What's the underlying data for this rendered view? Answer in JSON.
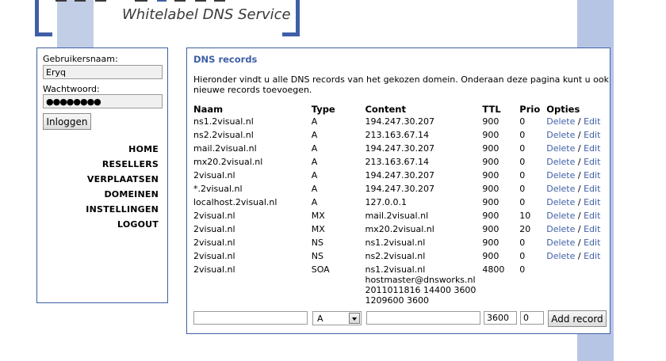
{
  "logo": {
    "tagline": "Whitelabel DNS Service"
  },
  "login": {
    "username_label": "Gebruikersnaam:",
    "username_value": "Eryq",
    "password_label": "Wachtwoord:",
    "password_value": "●●●●●●●●",
    "login_button": "Inloggen"
  },
  "menu": [
    "HOME",
    "RESELLERS",
    "VERPLAATSEN",
    "DOMEINEN",
    "INSTELLINGEN",
    "LOGOUT"
  ],
  "panel": {
    "title": "DNS records",
    "intro": "Hieronder vindt u alle DNS records van het gekozen domein. Onderaan deze pagina kunt u ook nieuwe records toevoegen."
  },
  "table": {
    "headers": [
      "Naam",
      "Type",
      "Content",
      "TTL",
      "Prio",
      "Opties"
    ],
    "rows": [
      {
        "naam": "ns1.2visual.nl",
        "type": "A",
        "content": "194.247.30.207",
        "ttl": "900",
        "prio": "0",
        "delete": "Delete",
        "edit": "Edit"
      },
      {
        "naam": "ns2.2visual.nl",
        "type": "A",
        "content": "213.163.67.14",
        "ttl": "900",
        "prio": "0",
        "delete": "Delete",
        "edit": "Edit"
      },
      {
        "naam": "mail.2visual.nl",
        "type": "A",
        "content": "194.247.30.207",
        "ttl": "900",
        "prio": "0",
        "delete": "Delete",
        "edit": "Edit"
      },
      {
        "naam": "mx20.2visual.nl",
        "type": "A",
        "content": "213.163.67.14",
        "ttl": "900",
        "prio": "0",
        "delete": "Delete",
        "edit": "Edit"
      },
      {
        "naam": "2visual.nl",
        "type": "A",
        "content": "194.247.30.207",
        "ttl": "900",
        "prio": "0",
        "delete": "Delete",
        "edit": "Edit"
      },
      {
        "naam": "*.2visual.nl",
        "type": "A",
        "content": "194.247.30.207",
        "ttl": "900",
        "prio": "0",
        "delete": "Delete",
        "edit": "Edit"
      },
      {
        "naam": "localhost.2visual.nl",
        "type": "A",
        "content": "127.0.0.1",
        "ttl": "900",
        "prio": "0",
        "delete": "Delete",
        "edit": "Edit"
      },
      {
        "naam": "2visual.nl",
        "type": "MX",
        "content": "mail.2visual.nl",
        "ttl": "900",
        "prio": "10",
        "delete": "Delete",
        "edit": "Edit"
      },
      {
        "naam": "2visual.nl",
        "type": "MX",
        "content": "mx20.2visual.nl",
        "ttl": "900",
        "prio": "20",
        "delete": "Delete",
        "edit": "Edit"
      },
      {
        "naam": "2visual.nl",
        "type": "NS",
        "content": "ns1.2visual.nl",
        "ttl": "900",
        "prio": "0",
        "delete": "Delete",
        "edit": "Edit"
      },
      {
        "naam": "2visual.nl",
        "type": "NS",
        "content": "ns2.2visual.nl",
        "ttl": "900",
        "prio": "0",
        "delete": "Delete",
        "edit": "Edit"
      }
    ],
    "soa": {
      "naam": "2visual.nl",
      "type": "SOA",
      "content_lines": [
        "ns1.2visual.nl",
        "hostmaster@dnsworks.nl",
        "2011011816 14400 3600",
        "1209600 3600"
      ],
      "ttl": "4800",
      "prio": "0"
    },
    "separator": "/"
  },
  "add_form": {
    "type_selected": "A",
    "ttl_value": "3600",
    "prio_value": "0",
    "add_button": "Add record"
  },
  "colors": {
    "accent": "#3f5fa6",
    "background_stripe": "#c2cde6"
  }
}
